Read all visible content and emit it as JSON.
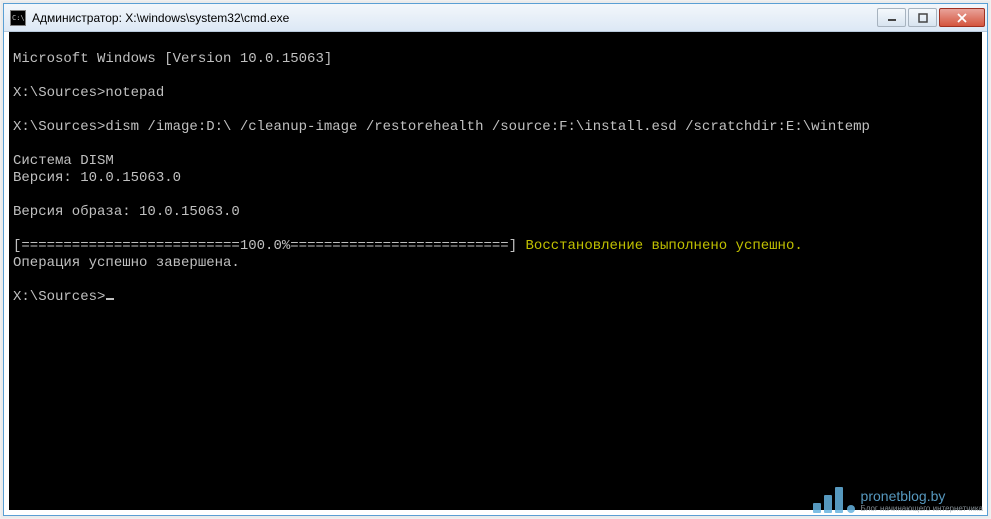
{
  "titlebar": {
    "icon_label": "C:\\",
    "title": "Администратор: X:\\windows\\system32\\cmd.exe",
    "minimize": "—",
    "maximize": "☐",
    "close": "✕"
  },
  "console": {
    "lines": [
      "Microsoft Windows [Version 10.0.15063]",
      "",
      "X:\\Sources>notepad",
      "",
      "X:\\Sources>dism /image:D:\\ /cleanup-image /restorehealth /source:F:\\install.esd /scratchdir:E:\\wintemp",
      "",
      "Cистема DISM",
      "Версия: 10.0.15063.0",
      "",
      "Версия образа: 10.0.15063.0",
      "",
      "",
      "Операция успешно завершена.",
      "",
      "X:\\Sources>"
    ],
    "progress": {
      "left": "[==========================",
      "pct": "100.0%",
      "right": "==========================] ",
      "status": "Восстановление выполнено успешно."
    }
  },
  "watermark": {
    "domain": "pronetblog.by",
    "tagline": "Блог начинающего интернетчика"
  }
}
